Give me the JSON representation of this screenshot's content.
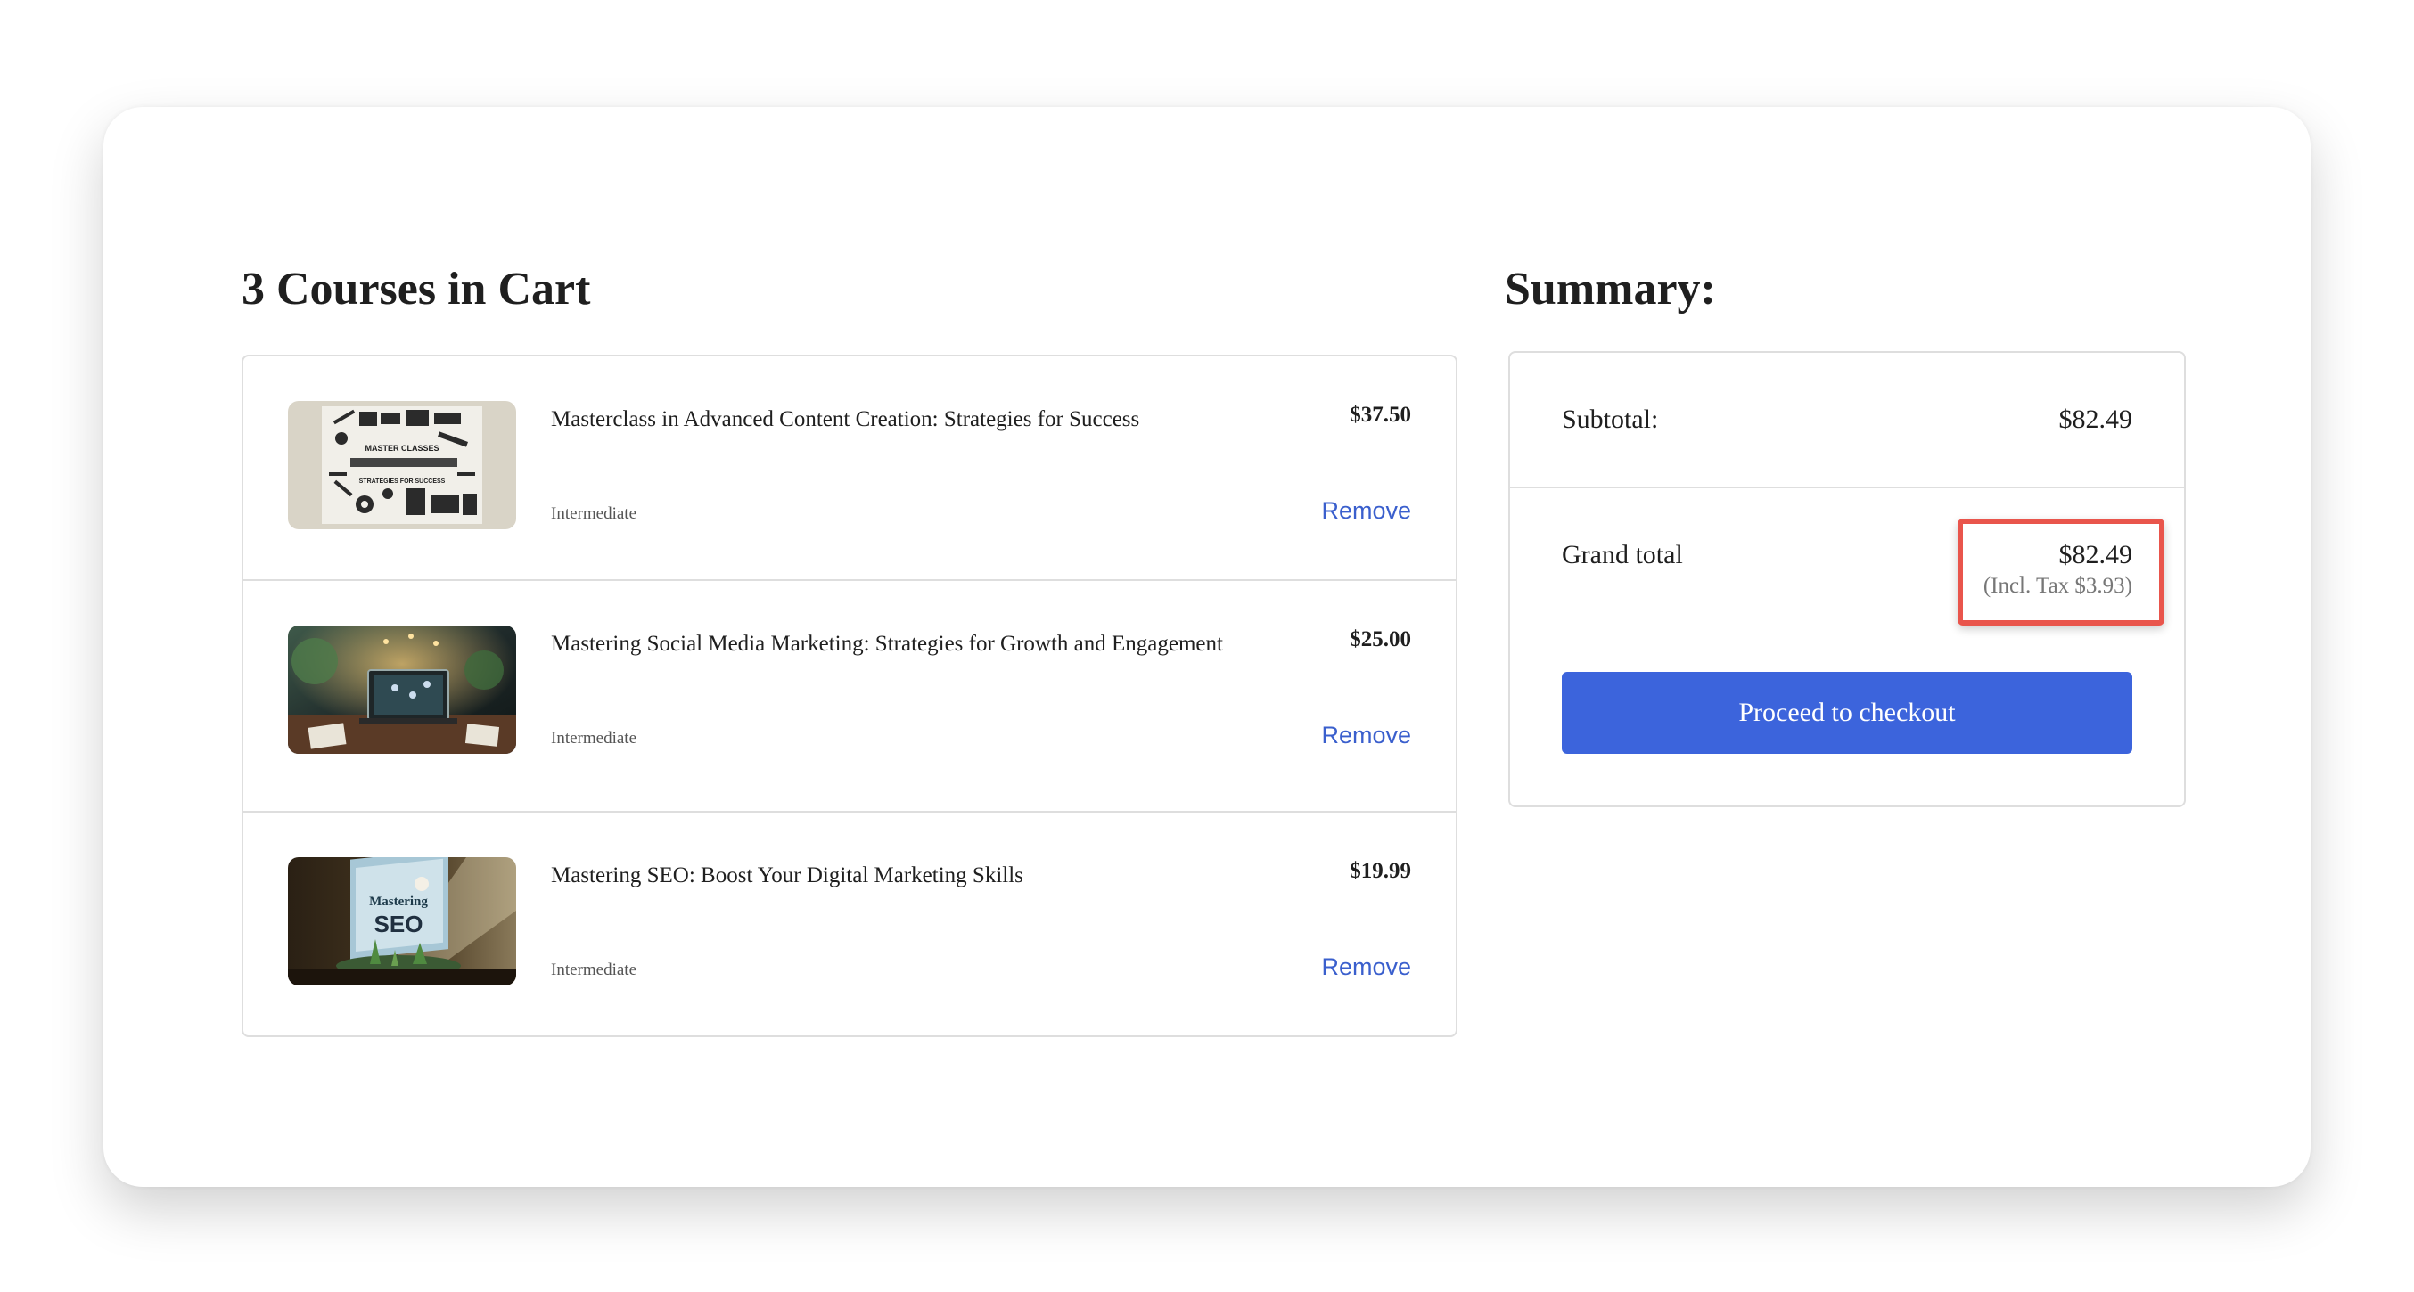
{
  "cart": {
    "heading": "3 Courses in Cart",
    "remove_label": "Remove",
    "items": [
      {
        "title": "Masterclass in Advanced Content Creation: Strategies for Success",
        "price": "$37.50",
        "level": "Intermediate",
        "thumbnail_text": [
          "MASTER CLASSES",
          "STRATEGIES FOR SUCCESS"
        ]
      },
      {
        "title": "Mastering Social Media Marketing: Strategies for Growth and Engagement",
        "price": "$25.00",
        "level": "Intermediate"
      },
      {
        "title": "Mastering SEO: Boost Your Digital Marketing Skills",
        "price": "$19.99",
        "level": "Intermediate",
        "thumbnail_text": [
          "Mastering",
          "SEO"
        ]
      }
    ]
  },
  "summary": {
    "heading": "Summary:",
    "subtotal_label": "Subtotal:",
    "subtotal_value": "$82.49",
    "grand_total_label": "Grand total",
    "grand_total_value": "$82.49",
    "tax_note": "(Incl. Tax $3.93)",
    "checkout_label": "Proceed to checkout"
  },
  "colors": {
    "accent": "#3c64dc",
    "link": "#3a5fcd",
    "highlight": "#e9554c"
  }
}
